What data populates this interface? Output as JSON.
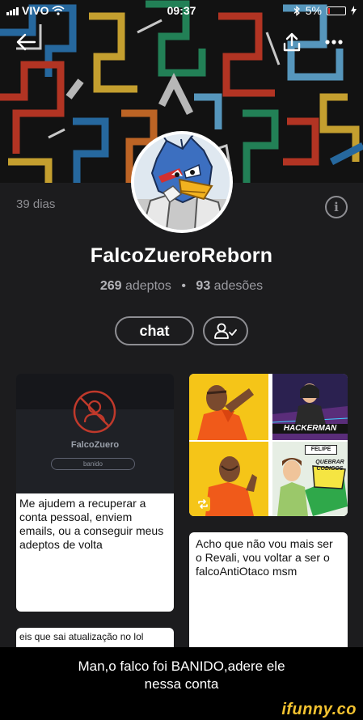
{
  "status_bar": {
    "carrier": "VIVO",
    "time": "09:37",
    "battery": "5%"
  },
  "profile": {
    "days": "39 dias",
    "username": "FalcoZueroReborn",
    "followers_count": "269",
    "followers_label": "adeptos",
    "following_count": "93",
    "following_label": "adesões",
    "separator": "•"
  },
  "actions": {
    "chat_label": "chat"
  },
  "posts": [
    {
      "banned_user": "FalcoZuero",
      "banned_status": "banido",
      "text": "Me ajudem a recuperar a conta pessoal, enviem emails, ou a conseguir meus adeptos de volta"
    },
    {
      "meme_label_1": "HACKERMAN",
      "meme_label_2": "FELIPE",
      "meme_label_3": "QUEBRAR CODIGOS"
    },
    {
      "text": "Acho que não vou mais ser o Revali, vou voltar a ser o falcoAntiOtaco msm"
    },
    {
      "text": "eis que sai atualização no lol"
    }
  ],
  "caption": {
    "line1": "Man,o falco foi BANIDO,adere ele",
    "line2": "nessa conta"
  },
  "watermark": "ifunny.co",
  "colors": {
    "background": "#1c1c1e",
    "muted_text": "#8e8e93",
    "watermark": "#f2c230"
  },
  "icons": {
    "back": "arrow-left-icon",
    "share": "share-icon",
    "more": "more-icon",
    "info": "info-icon",
    "follow": "user-check-icon",
    "repost": "repost-icon"
  }
}
